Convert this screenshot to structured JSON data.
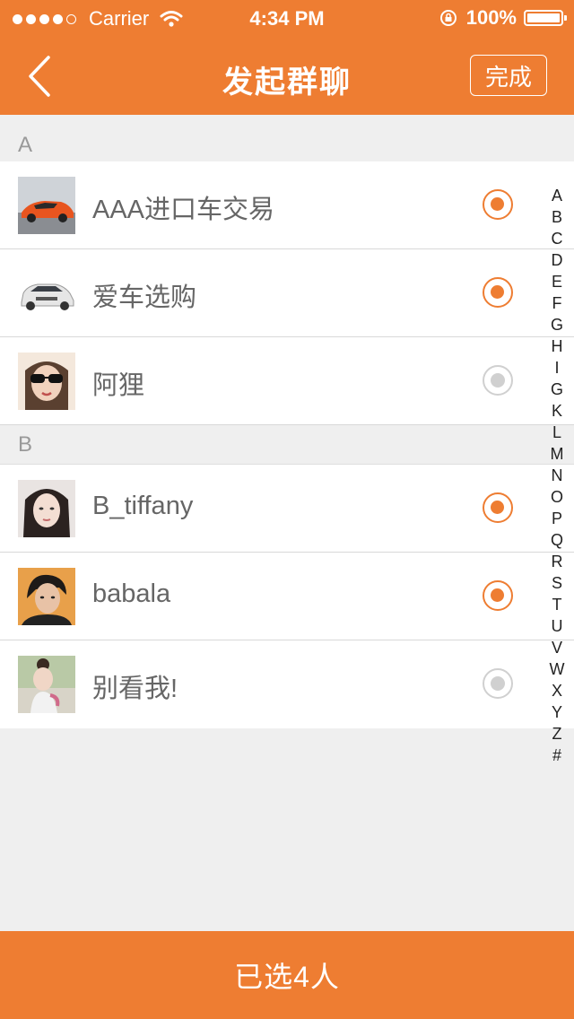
{
  "status_bar": {
    "carrier": "Carrier",
    "time": "4:34 PM",
    "battery": "100%"
  },
  "nav": {
    "title": "发起群聊",
    "done_label": "完成"
  },
  "sections": [
    {
      "letter": "A",
      "contacts": [
        {
          "name": "AAA进口车交易",
          "selected": true,
          "avatar": "orange-sports-car"
        },
        {
          "name": "爱车选购",
          "selected": true,
          "avatar": "white-suv"
        },
        {
          "name": "阿狸",
          "selected": false,
          "avatar": "woman-sunglasses"
        }
      ]
    },
    {
      "letter": "B",
      "contacts": [
        {
          "name": "B_tiffany",
          "selected": true,
          "avatar": "woman-portrait"
        },
        {
          "name": "babala",
          "selected": true,
          "avatar": "man-portrait"
        },
        {
          "name": "别看我!",
          "selected": false,
          "avatar": "woman-outdoor"
        }
      ]
    }
  ],
  "index_letters": [
    "A",
    "B",
    "C",
    "D",
    "E",
    "F",
    "G",
    "H",
    "I",
    "G",
    "K",
    "L",
    "M",
    "N",
    "O",
    "P",
    "Q",
    "R",
    "S",
    "T",
    "U",
    "V",
    "W",
    "X",
    "Y",
    "Z",
    "#"
  ],
  "bottom": {
    "selected_summary": "已选4人"
  },
  "colors": {
    "accent": "#ee7d32",
    "unselected": "#d0d0d0",
    "background": "#efefef"
  }
}
